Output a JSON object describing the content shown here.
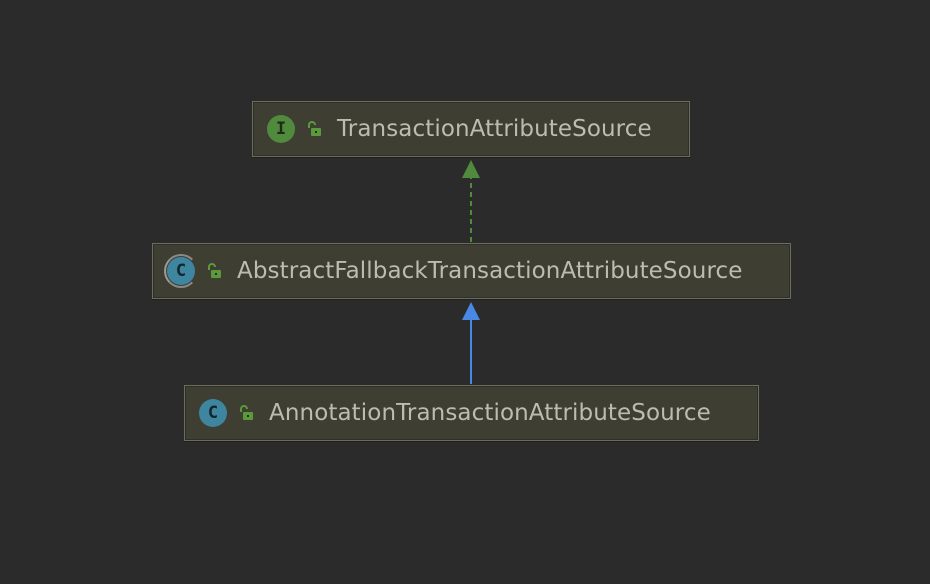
{
  "diagram": {
    "nodes": [
      {
        "id": "n1",
        "kind": "interface",
        "kind_letter": "I",
        "label": "TransactionAttributeSource"
      },
      {
        "id": "n2",
        "kind": "abstract",
        "kind_letter": "C",
        "label": "AbstractFallbackTransactionAttributeSource"
      },
      {
        "id": "n3",
        "kind": "class",
        "kind_letter": "C",
        "label": "AnnotationTransactionAttributeSource"
      }
    ],
    "edges": [
      {
        "from": "n2",
        "to": "n1",
        "type": "implements",
        "style": "dashed",
        "color": "#4f8a3d"
      },
      {
        "from": "n3",
        "to": "n2",
        "type": "extends",
        "style": "solid",
        "color": "#4a88e6"
      }
    ]
  },
  "colors": {
    "background": "#2b2b2b",
    "node_fill": "#3e3e33",
    "node_border": "#6c6c5a",
    "label_text": "#bcbcb0",
    "interface_icon": "#4f8a3d",
    "class_icon": "#3e86a0",
    "visibility_icon": "#5a9a3a"
  },
  "icons": {
    "interface": "interface-icon",
    "class": "class-icon",
    "abstract_class": "abstract-class-icon",
    "public_visibility": "unlocked-padlock-icon"
  }
}
